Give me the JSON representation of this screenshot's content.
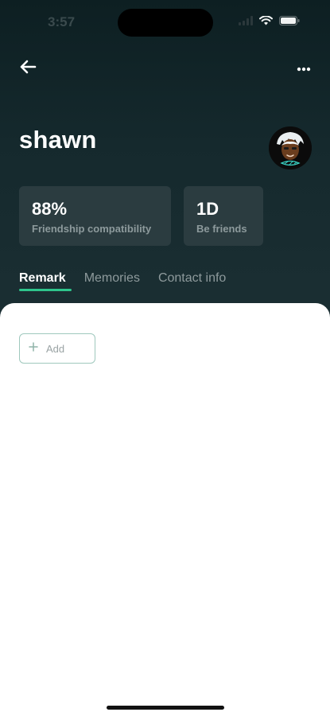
{
  "status_bar": {
    "time": "3:57"
  },
  "profile": {
    "name": "shawn"
  },
  "stats": [
    {
      "value": "88%",
      "label": "Friendship compatibility"
    },
    {
      "value": "1D",
      "label": "Be friends"
    }
  ],
  "tabs": [
    {
      "label": "Remark",
      "active": true
    },
    {
      "label": "Memories",
      "active": false
    },
    {
      "label": "Contact info",
      "active": false
    }
  ],
  "remark": {
    "add_label": "Add"
  },
  "colors": {
    "accent": "#2ec58c",
    "header_bg": "#15292d",
    "card_bg": "#2b3c40"
  }
}
